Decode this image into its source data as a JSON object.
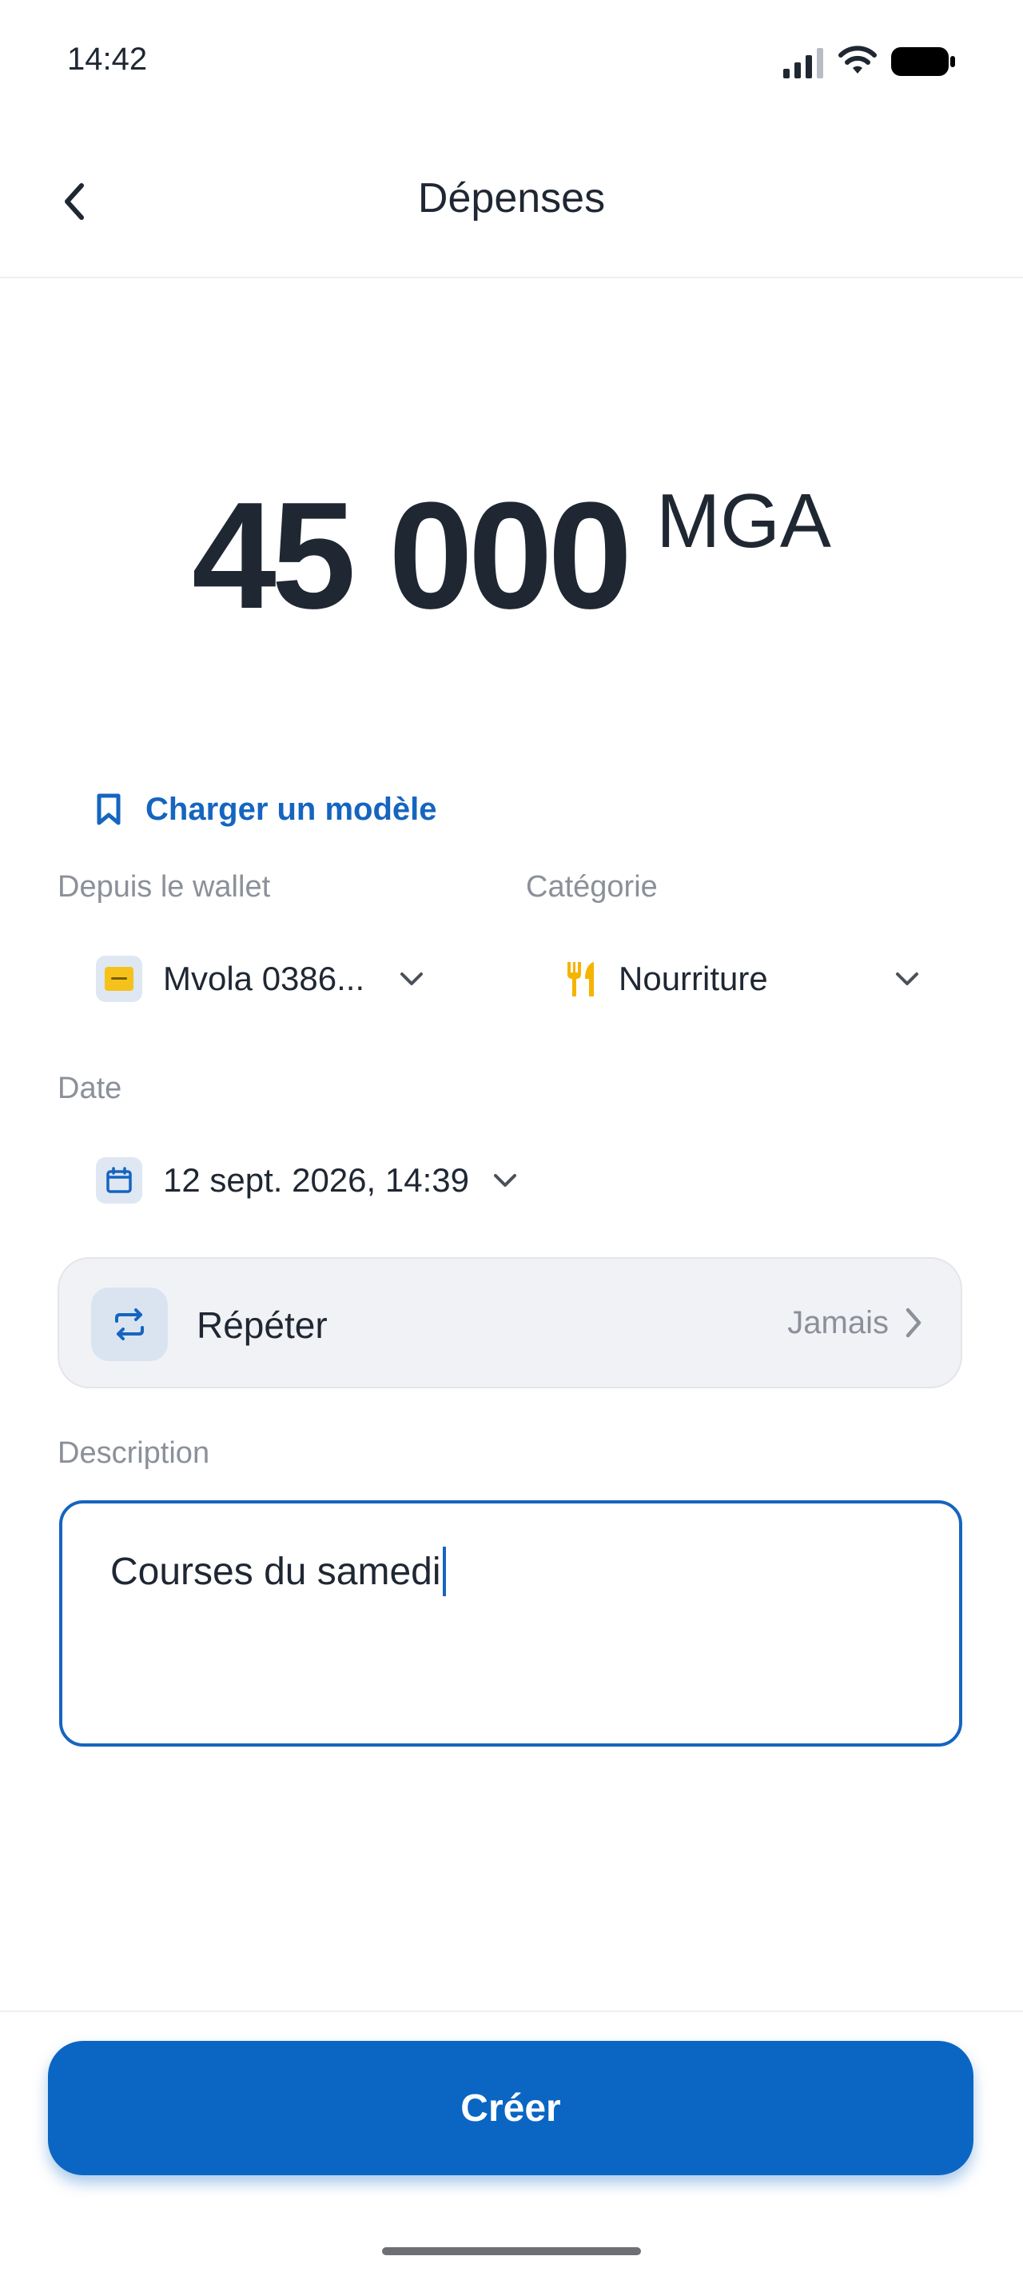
{
  "status_bar": {
    "time": "14:42"
  },
  "header": {
    "title": "Dépenses"
  },
  "amount": {
    "value": "45 000",
    "currency": "MGA"
  },
  "load_template": {
    "label": "Charger un modèle"
  },
  "wallet": {
    "label": "Depuis le wallet",
    "value": "Mvola 0386..."
  },
  "category": {
    "label": "Catégorie",
    "value": "Nourriture"
  },
  "date": {
    "label": "Date",
    "value": "12 sept. 2026, 14:39"
  },
  "repeat": {
    "label": "Répéter",
    "value": "Jamais"
  },
  "description": {
    "label": "Description",
    "value": "Courses du samedi"
  },
  "actions": {
    "create_label": "Créer"
  },
  "icons": {
    "back": "chevron-left-icon",
    "bookmark": "bookmark-icon",
    "wallet": "mvola-wallet-icon",
    "category": "fork-knife-icon",
    "calendar": "calendar-icon",
    "repeat": "repeat-icon",
    "dropdown": "chevron-down-icon",
    "chevron_right": "chevron-right-icon"
  },
  "colors": {
    "accent": "#0b66c3",
    "text_primary": "#1f2733",
    "text_secondary": "#8b9099",
    "category_icon": "#f5b400",
    "wallet_brand": "#f5c21b"
  }
}
